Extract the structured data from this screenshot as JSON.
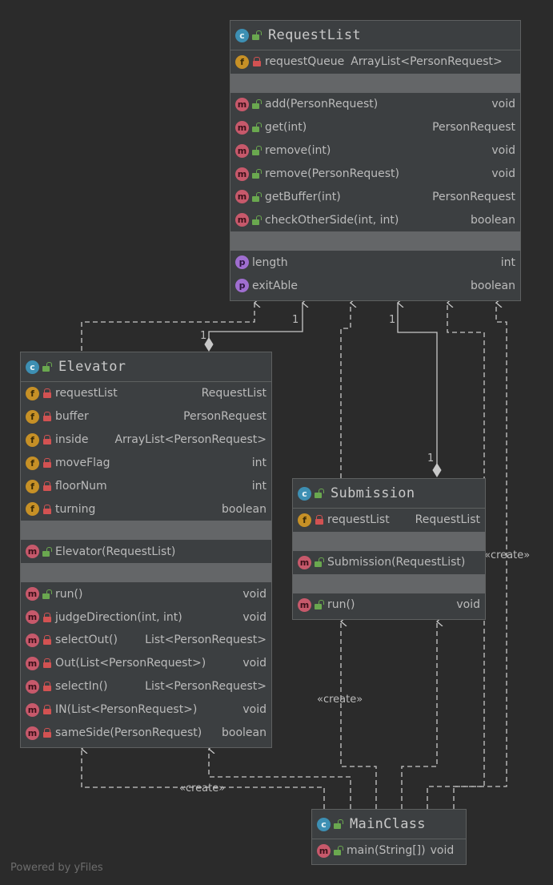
{
  "classes": {
    "requestlist": {
      "name": "RequestList",
      "fields": [
        {
          "name": "requestQueue",
          "type": "ArrayList<PersonRequest>"
        }
      ],
      "methods": [
        {
          "name": "add(PersonRequest)",
          "type": "void"
        },
        {
          "name": "get(int)",
          "type": "PersonRequest"
        },
        {
          "name": "remove(int)",
          "type": "void"
        },
        {
          "name": "remove(PersonRequest)",
          "type": "void"
        },
        {
          "name": "getBuffer(int)",
          "type": "PersonRequest"
        },
        {
          "name": "checkOtherSide(int, int)",
          "type": "boolean"
        }
      ],
      "properties": [
        {
          "name": "length",
          "type": "int"
        },
        {
          "name": "exitAble",
          "type": "boolean"
        }
      ]
    },
    "elevator": {
      "name": "Elevator",
      "fields": [
        {
          "name": "requestList",
          "type": "RequestList"
        },
        {
          "name": "buffer",
          "type": "PersonRequest"
        },
        {
          "name": "inside",
          "type": "ArrayList<PersonRequest>"
        },
        {
          "name": "moveFlag",
          "type": "int"
        },
        {
          "name": "floorNum",
          "type": "int"
        },
        {
          "name": "turning",
          "type": "boolean"
        }
      ],
      "constructors": [
        {
          "name": "Elevator(RequestList)",
          "type": ""
        }
      ],
      "methods": [
        {
          "name": "run()",
          "type": "void"
        },
        {
          "name": "judgeDirection(int, int)",
          "type": "void"
        },
        {
          "name": "selectOut()",
          "type": "List<PersonRequest>"
        },
        {
          "name": "Out(List<PersonRequest>)",
          "type": "void"
        },
        {
          "name": "selectIn()",
          "type": "List<PersonRequest>"
        },
        {
          "name": "IN(List<PersonRequest>)",
          "type": "void"
        },
        {
          "name": "sameSide(PersonRequest)",
          "type": "boolean"
        }
      ]
    },
    "submission": {
      "name": "Submission",
      "fields": [
        {
          "name": "requestList",
          "type": "RequestList"
        }
      ],
      "constructors": [
        {
          "name": "Submission(RequestList)",
          "type": ""
        }
      ],
      "methods": [
        {
          "name": "run()",
          "type": "void"
        }
      ]
    },
    "mainclass": {
      "name": "MainClass",
      "methods": [
        {
          "name": "main(String[])",
          "type": "void"
        }
      ]
    }
  },
  "edges": {
    "multiplicity_elevator": "1",
    "multiplicity_requestlist_left": "1",
    "multiplicity_requestlist_right": "1",
    "multiplicity_submission": "1",
    "create_right": "«create»",
    "create_mid": "«create»",
    "create_bottom": "«create»"
  },
  "badges": {
    "class": "c",
    "field": "f",
    "method": "m",
    "property": "p"
  },
  "footer": "Powered by yFiles",
  "colors": {
    "background": "#2b2b2b",
    "box": "#3c3f41",
    "separator": "#646668",
    "line": "#c8c8c8",
    "class_badge": "#3d8fb3",
    "field_badge": "#c69026",
    "method_badge": "#c7596b",
    "property_badge": "#9f6ed0"
  }
}
